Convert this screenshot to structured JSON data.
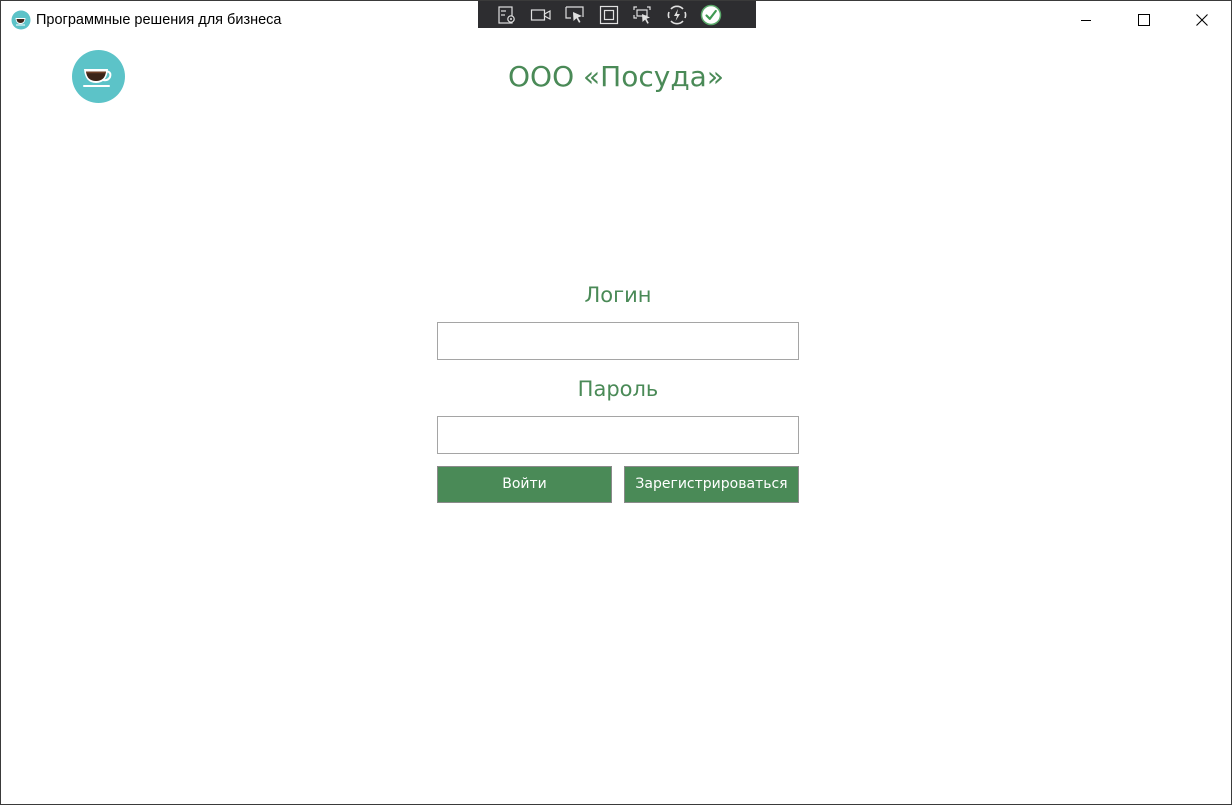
{
  "window": {
    "title": "Программные решения для бизнеса",
    "controls": [
      "minimize-icon",
      "maximize-icon",
      "close-icon"
    ]
  },
  "debug_toolbar": {
    "icons": [
      "live-visual-tree-icon",
      "record-icon",
      "select-element-icon",
      "display-layout-adorners-icon",
      "track-focused-element-icon",
      "hot-reload-icon",
      "hot-reload-status-check-icon"
    ]
  },
  "header": {
    "logo_icon": "coffee-cup-icon",
    "company_name": "ООО «Посуда»"
  },
  "form": {
    "login_label": "Логин",
    "login_value": "",
    "password_label": "Пароль",
    "password_value": "",
    "login_button": "Войти",
    "register_button": "Зарегистрироваться"
  },
  "colors": {
    "accent_green": "#4a8a57",
    "logo_circle": "#5cc3c8",
    "toolbar_bg": "#2d2d30"
  }
}
